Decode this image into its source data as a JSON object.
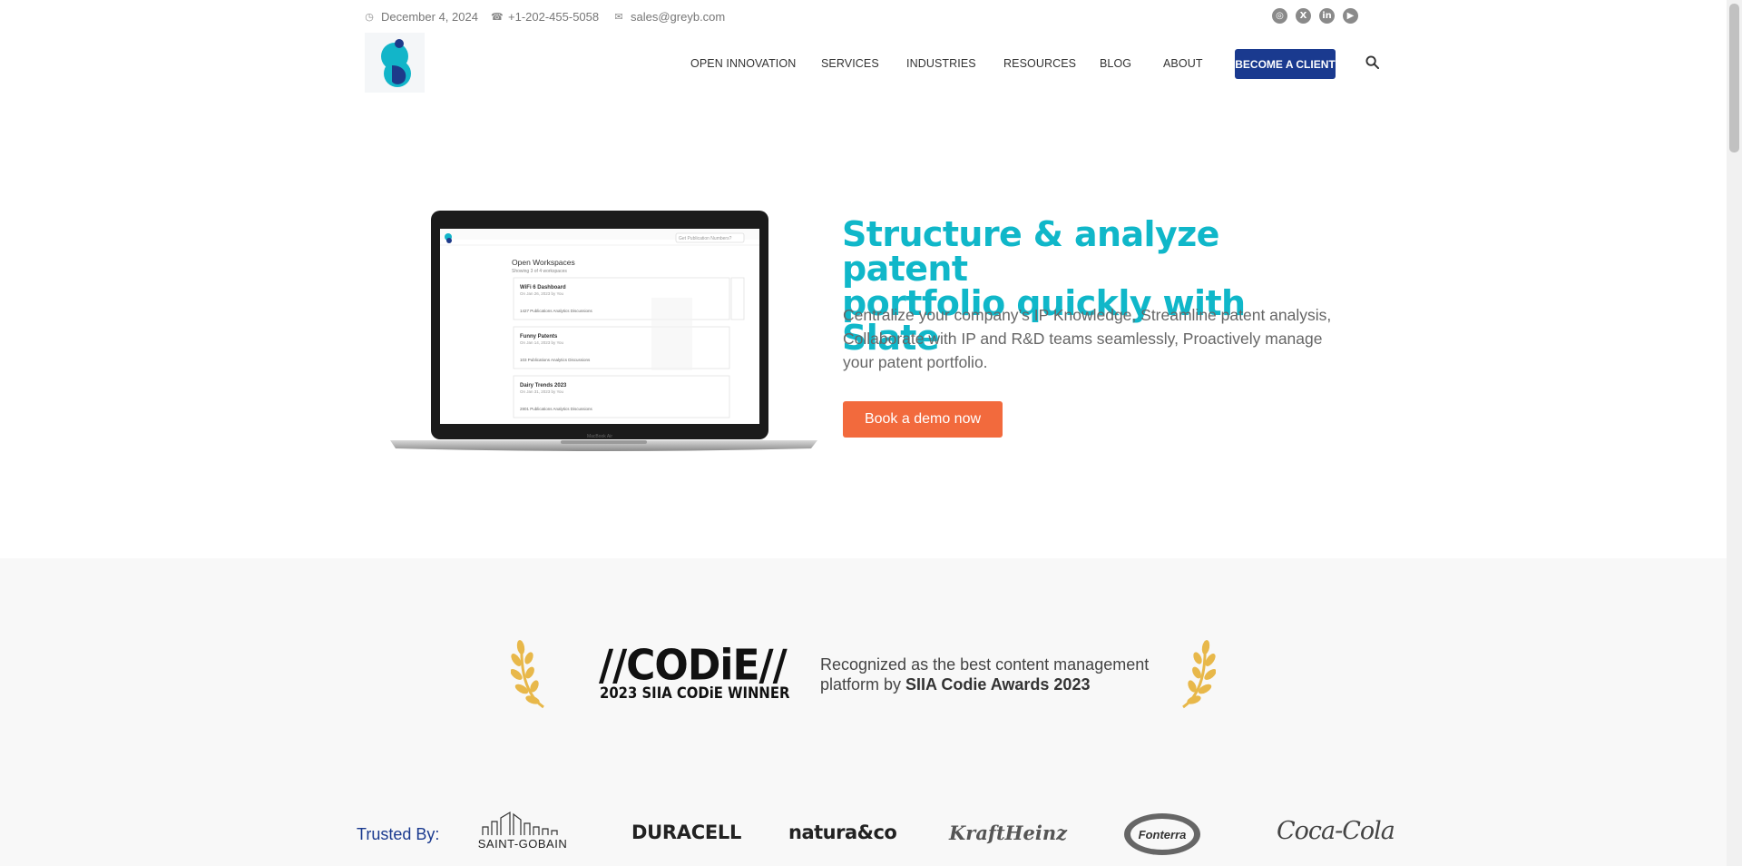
{
  "topbar": {
    "date": "December 4, 2024",
    "phone": "+1-202-455-5058",
    "email": "sales@greyb.com",
    "social_icons": [
      "instagram-icon",
      "x-icon",
      "linkedin-icon",
      "youtube-icon"
    ]
  },
  "nav": {
    "items": [
      "OPEN INNOVATION",
      "SERVICES",
      "INDUSTRIES",
      "RESOURCES",
      "BLOG",
      "ABOUT"
    ],
    "cta": "BECOME A CLIENT"
  },
  "hero": {
    "title_line1": "Structure & analyze patent",
    "title_line2": "portfolio quickly with Slate",
    "description": "Centralize your company’s IP Knowledge, Streamline patent analysis, Collaborate with IP and R&D teams seamlessly, Proactively manage your patent portfolio.",
    "button": "Book a demo now",
    "screen": {
      "search_placeholder": "Get Publication Numbers?",
      "heading": "Open Workspaces",
      "subheading": "Showing 3 of 4 workspaces",
      "cards": [
        {
          "title": "WiFi 6 Dashboard",
          "meta": "On Jan 26, 2023 by You",
          "stats": "1427 Publications   Analytics   Discussions"
        },
        {
          "title": "Funny Patents",
          "meta": "On Jan 14, 2023 by You",
          "stats": "103 Publications   Analytics   Discussions"
        },
        {
          "title": "Dairy Trends 2023",
          "meta": "On Jan 31, 2023 by You",
          "stats": "2801 Publications   Analytics   Discussions"
        }
      ],
      "laptop_label": "MacBook Air"
    }
  },
  "award": {
    "logo_text": "//CODiE//",
    "logo_sub": "2023 SIIA CODiE WINNER",
    "text_prefix": "Recognized as the best content management platform by ",
    "text_bold": "SIIA Codie Awards 2023"
  },
  "trusted": {
    "label": "Trusted By:",
    "brands": [
      "SAINT-GOBAIN",
      "DURACELL",
      "natura&co",
      "KraftHeinz",
      "Fonterra",
      "Coca-Cola"
    ]
  },
  "colors": {
    "accent_teal": "#10b7c9",
    "nav_blue": "#1a3a8f",
    "cta_orange": "#f26a3d",
    "laurel_gold": "#e8b84a"
  }
}
